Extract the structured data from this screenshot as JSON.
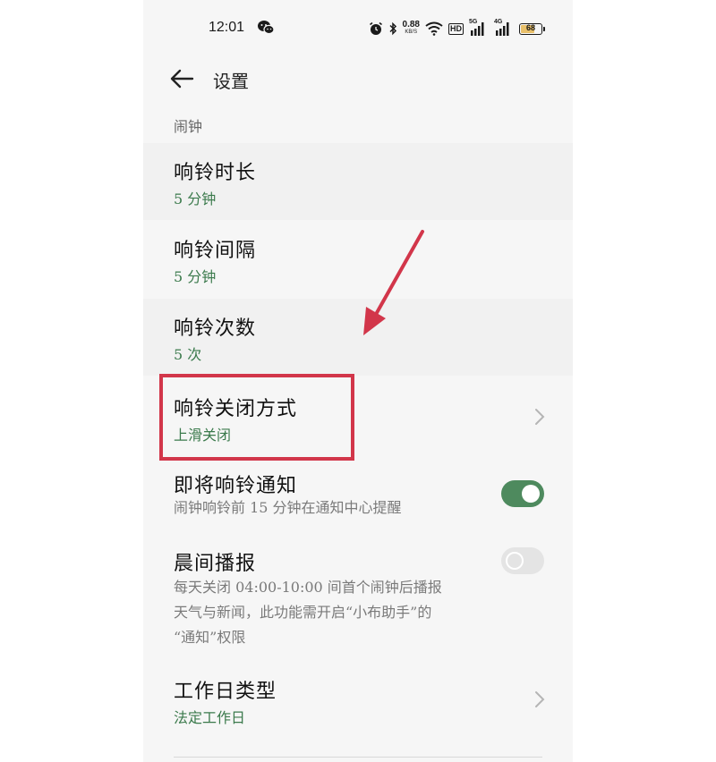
{
  "status_bar": {
    "time": "12:01",
    "network_speed": "0.88",
    "network_speed_unit": "KB/S",
    "hd_label": "HD",
    "signal_1_label": "5G",
    "signal_2_label": "4G",
    "battery_level": "68"
  },
  "header": {
    "title": "设置"
  },
  "section": {
    "label": "闹钟"
  },
  "items": [
    {
      "title": "响铃时长",
      "subtitle": "5 分钟"
    },
    {
      "title": "响铃间隔",
      "subtitle": "5 分钟"
    },
    {
      "title": "响铃次数",
      "subtitle": "5 次"
    },
    {
      "title": "响铃关闭方式",
      "subtitle": "上滑关闭"
    },
    {
      "title": "即将响铃通知",
      "subtitle": "闹钟响铃前 15 分钟在通知中心提醒",
      "toggle": true
    },
    {
      "title": "晨间播报",
      "subtitle_lines": [
        "每天关闭 04:00-10:00 间首个闹钟后播报",
        "天气与新闻，此功能需开启“小布助手”的",
        "“通知”权限"
      ],
      "toggle": false
    },
    {
      "title": "工作日类型",
      "subtitle": "法定工作日"
    }
  ],
  "colors": {
    "accent_green": "#4e8a5e",
    "subtitle_green": "#3b7a4c",
    "annotation_red": "#d2364a"
  }
}
